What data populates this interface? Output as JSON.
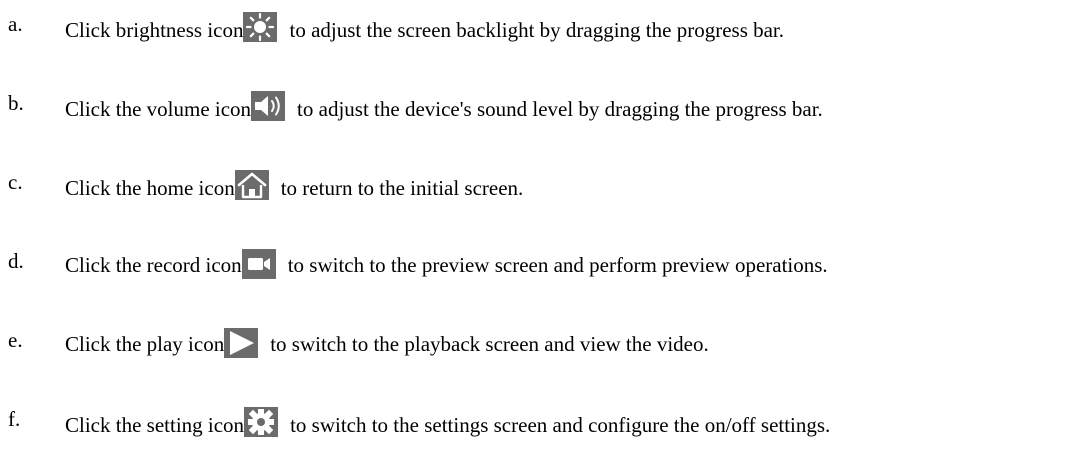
{
  "items": [
    {
      "marker": "a.",
      "before": "Click brightness icon",
      "icon": "brightness-icon",
      "after": "to adjust the screen backlight by dragging the progress bar."
    },
    {
      "marker": "b.",
      "before": "Click the volume icon",
      "icon": "volume-icon",
      "after": "to adjust the device's sound level by dragging the progress bar."
    },
    {
      "marker": "c.",
      "before": "Click the home icon",
      "icon": "home-icon",
      "after": "to return to the initial screen."
    },
    {
      "marker": "d.",
      "before": "Click the record icon",
      "icon": "record-icon",
      "after": "to switch to the preview screen and perform preview operations."
    },
    {
      "marker": "e.",
      "before": "Click the play icon",
      "icon": "play-icon",
      "after": "to switch to the playback screen and view the video."
    },
    {
      "marker": "f.",
      "before": "Click the setting icon",
      "icon": "setting-icon",
      "after": "to switch to the settings screen and configure the on/off settings."
    }
  ],
  "colors": {
    "icon_background": "#6b6b6b",
    "icon_foreground": "#ffffff",
    "text": "#000000"
  }
}
